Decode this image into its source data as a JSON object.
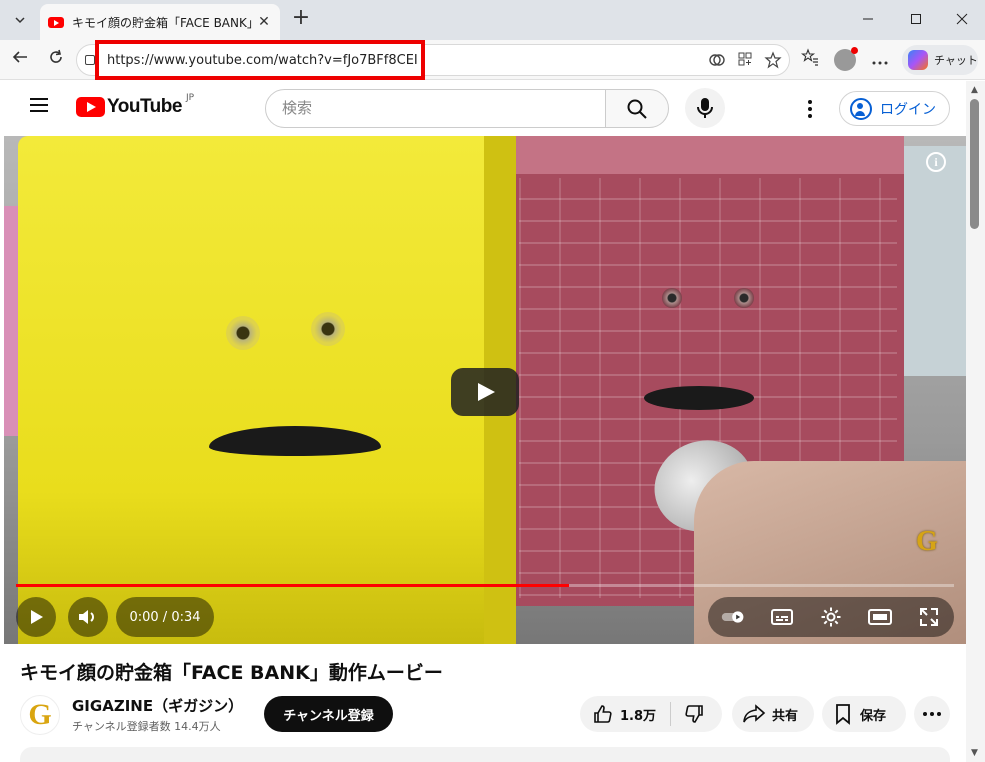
{
  "browser": {
    "tab_title": "キモイ顔の貯金箱「FACE BANK」動作ムービー",
    "url": "https://www.youtube.com/watch?v=fJo7BFf8CEI",
    "copilot_label": "チャット",
    "new_tab_symbol": "+",
    "close_symbol": "✕",
    "minimize_symbol": "—",
    "maximize_symbol": "☐",
    "window_close_symbol": "✕"
  },
  "youtube": {
    "logo_word": "YouTube",
    "logo_region": "JP",
    "search_placeholder": "検索",
    "login_label": "ログイン"
  },
  "player": {
    "time_display": "0:00 / 0:34",
    "progress_fraction": 0.59,
    "info_symbol": "i",
    "watermark": "G"
  },
  "video": {
    "title": "キモイ顔の貯金箱「FACE BANK」動作ムービー",
    "channel_name": "GIGAZINE（ギガジン）",
    "channel_subs": "チャンネル登録者数 14.4万人",
    "channel_avatar_letter": "G",
    "subscribe_label": "チャンネル登録",
    "like_count": "1.8万",
    "share_label": "共有",
    "save_label": "保存"
  },
  "colors": {
    "accent_red": "#ff0000",
    "link_blue": "#065fd4",
    "highlight_red": "#ee0000"
  }
}
